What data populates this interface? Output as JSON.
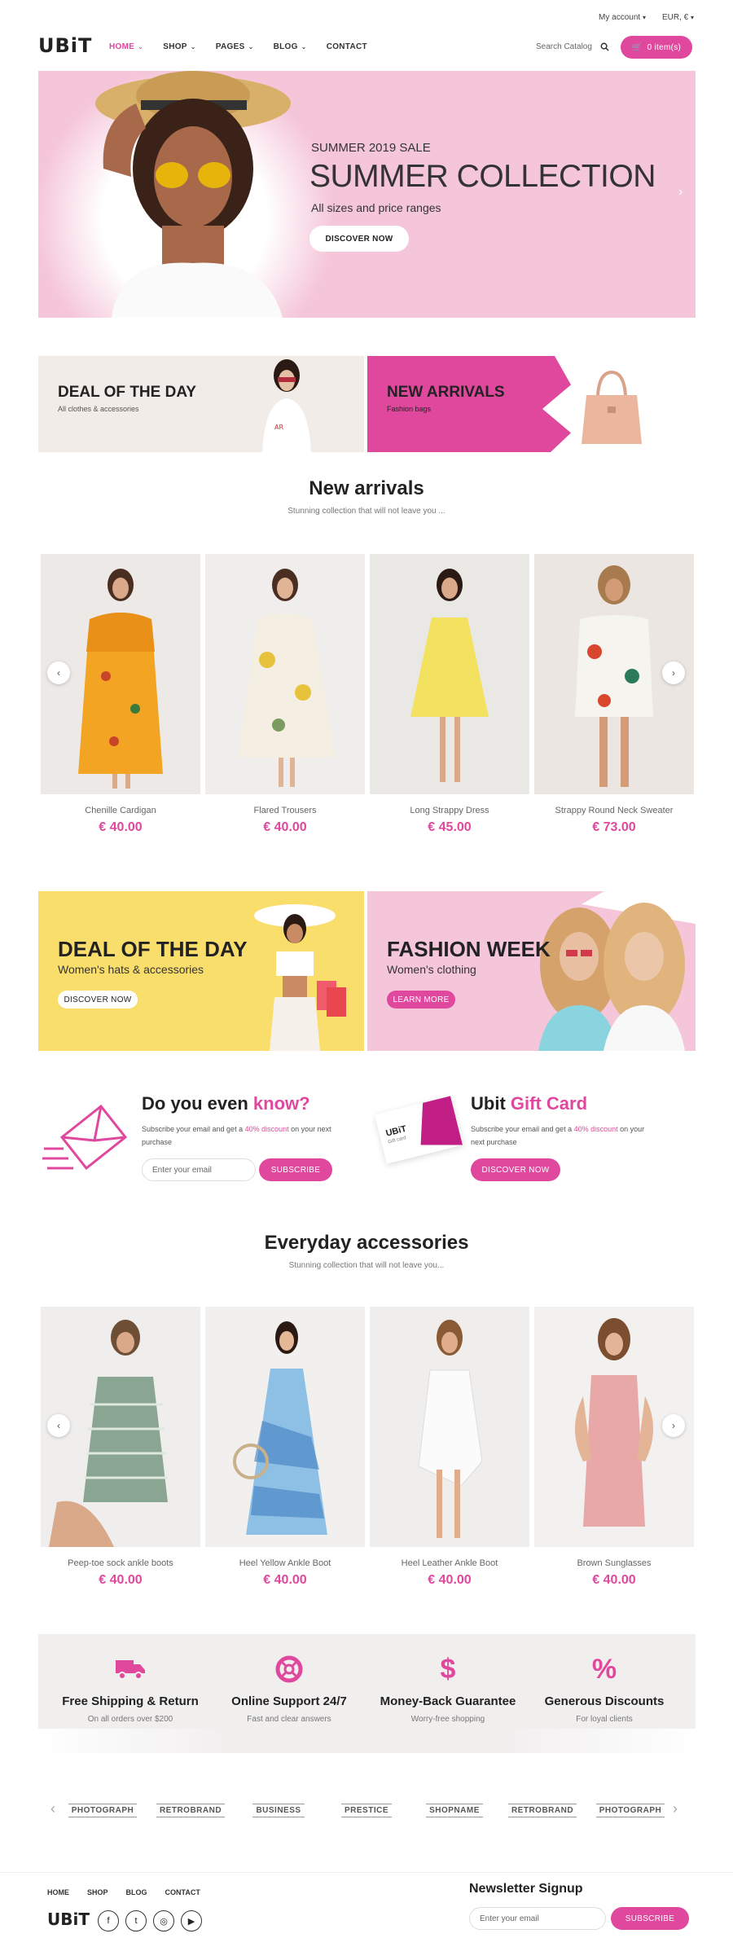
{
  "topbar": {
    "account": "My account",
    "currency": "EUR, €"
  },
  "header": {
    "logo": "UBiT",
    "nav": [
      {
        "label": "HOME",
        "chevron": true,
        "active": true
      },
      {
        "label": "SHOP",
        "chevron": true
      },
      {
        "label": "PAGES",
        "chevron": true
      },
      {
        "label": "BLOG",
        "chevron": true
      },
      {
        "label": "CONTACT",
        "chevron": false
      }
    ],
    "search_placeholder": "Search Catalog",
    "cart": "0 item(s)"
  },
  "hero": {
    "kicker": "SUMMER 2019 SALE",
    "title": "SUMMER COLLECTION",
    "subtitle": "All sizes and price ranges",
    "button": "DISCOVER NOW",
    "bg": "#f5c6d9"
  },
  "promo_top": [
    {
      "title": "DEAL OF THE DAY",
      "sub": "All clothes & accessories"
    },
    {
      "title": "NEW ARRIVALS",
      "sub": "Fashion bags"
    }
  ],
  "new_arrivals": {
    "title": "New arrivals",
    "subtitle": "Stunning collection that will not leave you ...",
    "products": [
      {
        "name": "Chenille Cardigan",
        "price": "€ 40.00"
      },
      {
        "name": "Flared Trousers",
        "price": "€ 40.00"
      },
      {
        "name": "Long Strappy Dress",
        "price": "€ 45.00"
      },
      {
        "name": "Strappy Round Neck Sweater",
        "price": "€ 73.00"
      }
    ]
  },
  "promo_mid": [
    {
      "title": "DEAL OF THE DAY",
      "sub": "Women's hats & accessories",
      "button": "DISCOVER NOW"
    },
    {
      "title": "FASHION WEEK",
      "sub": "Women's clothing",
      "button": "LEARN MORE"
    }
  ],
  "know": {
    "title_a": "Do you even ",
    "title_b": "know?",
    "text_a": "Subscribe your email and get a ",
    "text_b": "40% discount",
    "text_c": " on your next purchase",
    "placeholder": "Enter your email",
    "button": "SUBSCRIBE"
  },
  "giftcard": {
    "title_a": "Ubit ",
    "title_b": "Gift Card",
    "text_a": "Subscribe your email and get a ",
    "text_b": "40% discount",
    "text_c": " on your next purchase",
    "button": "DISCOVER NOW",
    "card_logo": "UBiT",
    "card_text": "Gift card"
  },
  "accessories": {
    "title": "Everyday accessories",
    "subtitle": "Stunning collection that will not leave you...",
    "products": [
      {
        "name": "Peep-toe sock ankle boots",
        "price": "€ 40.00"
      },
      {
        "name": "Heel Yellow Ankle Boot",
        "price": "€ 40.00"
      },
      {
        "name": "Heel Leather Ankle Boot",
        "price": "€ 40.00"
      },
      {
        "name": "Brown Sunglasses",
        "price": "€ 40.00"
      }
    ]
  },
  "features": [
    {
      "icon": "truck-icon",
      "title": "Free Shipping & Return",
      "sub": "On all orders over $200"
    },
    {
      "icon": "lifebuoy-icon",
      "title": "Online Support 24/7",
      "sub": "Fast and clear answers"
    },
    {
      "icon": "dollar-icon",
      "title": "Money-Back Guarantee",
      "sub": "Worry-free shopping"
    },
    {
      "icon": "percent-icon",
      "title": "Generous Discounts",
      "sub": "For loyal clients"
    }
  ],
  "brands": [
    "PHOTOGRAPH",
    "RETROBRAND",
    "BUSINESS",
    "PRESTICE",
    "SHOPNAME",
    "RETROBRAND",
    "PHOTOGRAPH"
  ],
  "footer": {
    "links": [
      "HOME",
      "SHOP",
      "BLOG",
      "CONTACT"
    ],
    "logo": "UBiT",
    "newsletter_title": "Newsletter Signup",
    "placeholder": "Enter your email",
    "button": "SUBSCRIBE"
  },
  "colors": {
    "accent": "#e0489e",
    "yellow": "#f9de6c",
    "pink_bg": "#f5c6d9",
    "beige": "#f2ece8",
    "gray_band": "#f1eeee"
  }
}
